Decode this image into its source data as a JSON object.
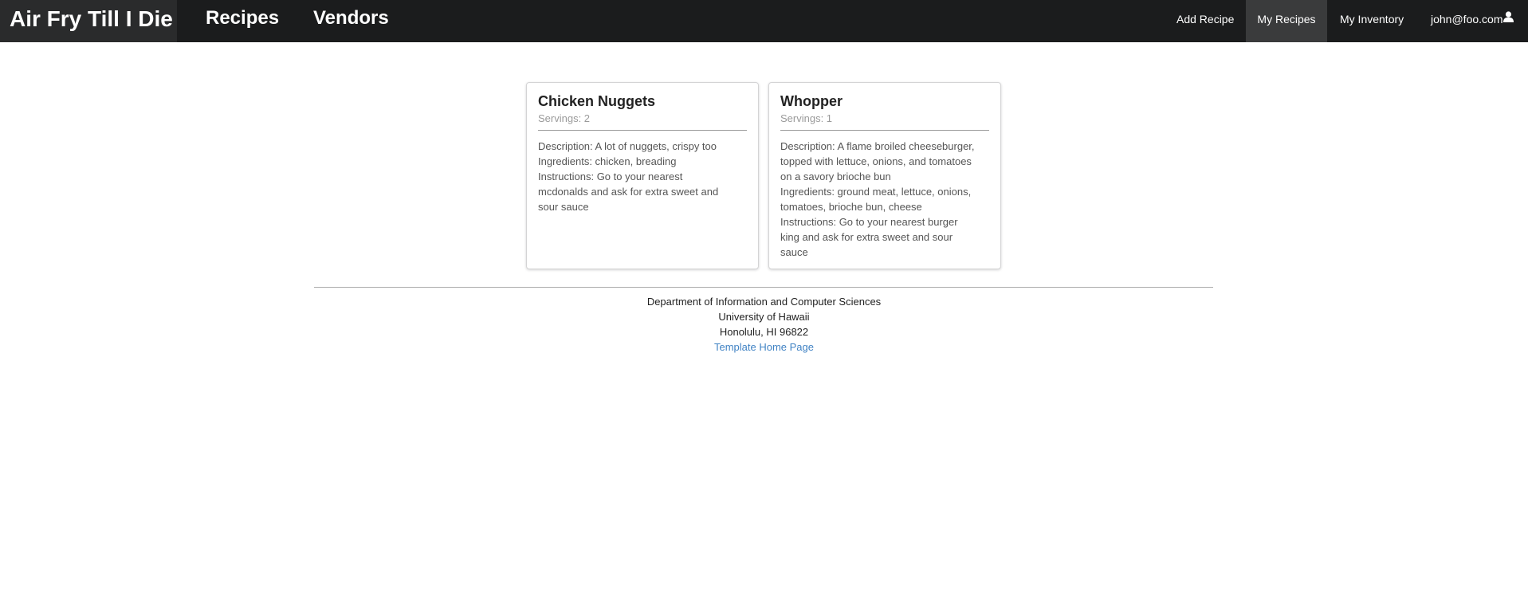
{
  "navbar": {
    "brand": "Air Fry Till I Die",
    "links": [
      "Recipes",
      "Vendors"
    ],
    "right": {
      "add_recipe": "Add Recipe",
      "my_recipes": "My Recipes",
      "my_inventory": "My Inventory",
      "user": "john@foo.com",
      "user_icon": "user-icon"
    },
    "active_item": "My Recipes"
  },
  "cards": [
    {
      "title": "Chicken Nuggets",
      "meta": "Servings: 2",
      "lines": [
        "Description: A lot of nuggets, crispy too",
        "Ingredients: chicken, breading",
        "Instructions: Go to your nearest",
        "mcdonalds and ask for extra sweet and",
        "sour sauce"
      ]
    },
    {
      "title": "Whopper",
      "meta": "Servings: 1",
      "lines": [
        "Description: A flame broiled cheeseburger,",
        "topped with lettuce, onions, and tomatoes",
        "on a savory brioche bun",
        "Ingredients: ground meat, lettuce, onions,",
        "tomatoes, brioche bun, cheese",
        "Instructions: Go to your nearest burger",
        "king and ask for extra sweet and sour",
        "sauce"
      ]
    }
  ],
  "footer": {
    "lines": [
      "Department of Information and Computer Sciences",
      "University of Hawaii",
      "Honolulu, HI 96822"
    ],
    "link": "Template Home Page"
  },
  "colors": {
    "navbar_bg": "#1b1c1d",
    "active_bg": "#3a3b3c",
    "link": "#4183c4"
  }
}
